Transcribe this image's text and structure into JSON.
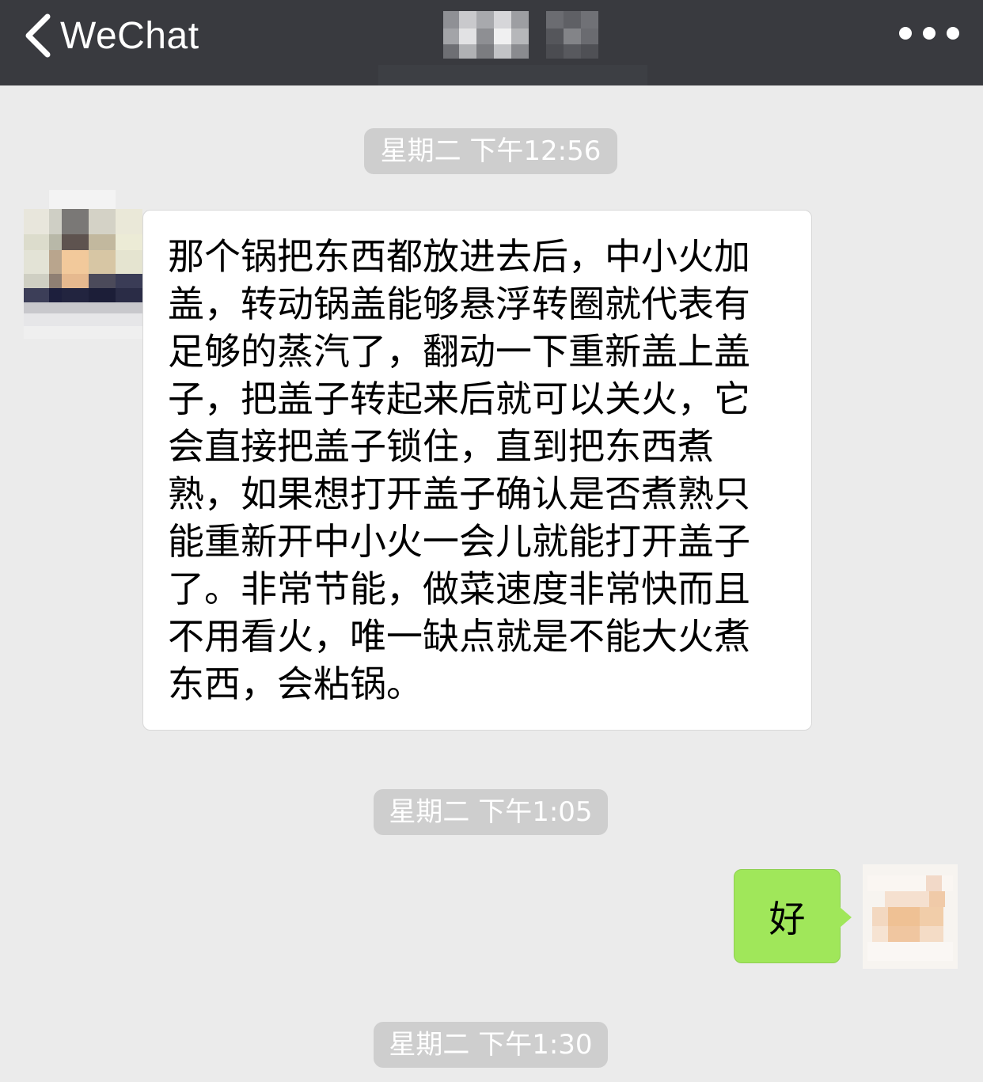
{
  "navbar": {
    "back_label": "WeChat",
    "back_icon": "chevron-left-icon",
    "more_icon": "ellipsis-icon",
    "background": "#393a3f"
  },
  "chat": {
    "timestamps": [
      "星期二 下午12:56",
      "星期二 下午1:05",
      "星期二 下午1:30"
    ],
    "messages": [
      {
        "direction": "incoming",
        "text": "那个锅把东西都放进去后，中小火加\n盖，转动锅盖能够悬浮转圈就代表有\n足够的蒸汽了，翻动一下重新盖上盖\n子，把盖子转起来后就可以关火，它\n会直接把盖子锁住，直到把东西煮\n熟，如果想打开盖子确认是否煮熟只\n能重新开中小火一会儿就能打开盖子\n了。非常节能，做菜速度非常快而且\n不用看火，唯一缺点就是不能大火煮\n东西，会粘锅。"
      },
      {
        "direction": "outgoing",
        "text": "好"
      }
    ]
  },
  "colors": {
    "chat_background": "#ebebeb",
    "incoming_bubble": "#ffffff",
    "outgoing_bubble": "#a0e75a",
    "timestamp_pill": "#cecece"
  }
}
